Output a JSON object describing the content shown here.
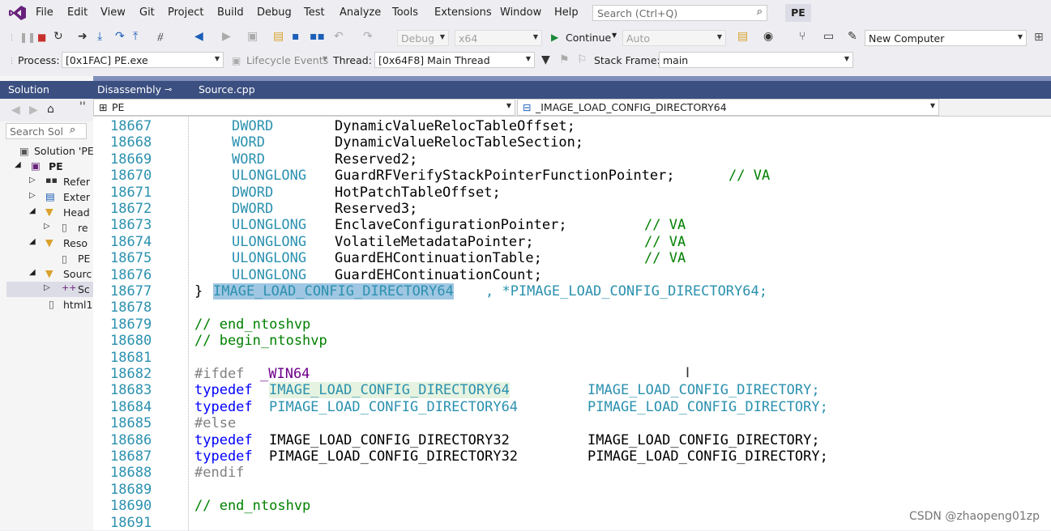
{
  "menubar": {
    "items": [
      "File",
      "Edit",
      "View",
      "Git",
      "Project",
      "Build",
      "Debug",
      "Test",
      "Analyze",
      "Tools",
      "Extensions",
      "Window",
      "Help"
    ],
    "search_placeholder": "Search (Ctrl+Q)",
    "solution_badge": "PE"
  },
  "toolbar1": {
    "config": "Debug",
    "platform": "x64",
    "continue_label": "Continue",
    "startup_item": "Auto",
    "target": "New Computer"
  },
  "toolbar2": {
    "process_label": "Process:",
    "process_value": "[0x1FAC] PE.exe",
    "lifecycle_label": "Lifecycle Events",
    "thread_label": "Thread:",
    "thread_value": "[0x64F8] Main Thread",
    "stackframe_label": "Stack Frame:",
    "stackframe_value": "main"
  },
  "solution_explorer": {
    "title": "Solution Explo...",
    "search_placeholder": "Search Sol",
    "items": [
      "Solution 'PE",
      "PE",
      "Refer",
      "Exter",
      "Head",
      "re",
      "Reso",
      "PE",
      "Sourc",
      "Sc",
      "html1"
    ]
  },
  "tabs": [
    "Disassembly",
    "Source.cpp"
  ],
  "navbar": {
    "scope": "PE",
    "member": "_IMAGE_LOAD_CONFIG_DIRECTORY64"
  },
  "editor": {
    "line_numbers": [
      "18667",
      "18668",
      "18669",
      "18670",
      "18671",
      "18672",
      "18673",
      "18674",
      "18675",
      "18676",
      "18677",
      "18678",
      "18679",
      "18680",
      "18681",
      "18682",
      "18683",
      "18684",
      "18685",
      "18686",
      "18687",
      "18688",
      "18689",
      "18690",
      "18691"
    ],
    "fields": [
      {
        "type": "DWORD",
        "name": "DynamicValueRelocTableOffset;",
        "comment": ""
      },
      {
        "type": "WORD",
        "name": "DynamicValueRelocTableSection;",
        "comment": ""
      },
      {
        "type": "WORD",
        "name": "Reserved2;",
        "comment": ""
      },
      {
        "type": "ULONGLONG",
        "name": "GuardRFVerifyStackPointerFunctionPointer;",
        "comment": "// VA"
      },
      {
        "type": "DWORD",
        "name": "HotPatchTableOffset;",
        "comment": ""
      },
      {
        "type": "DWORD",
        "name": "Reserved3;",
        "comment": ""
      },
      {
        "type": "ULONGLONG",
        "name": "EnclaveConfigurationPointer;",
        "comment": "// VA"
      },
      {
        "type": "ULONGLONG",
        "name": "VolatileMetadataPointer;",
        "comment": "// VA"
      },
      {
        "type": "ULONGLONG",
        "name": "GuardEHContinuationTable;",
        "comment": "// VA"
      },
      {
        "type": "ULONGLONG",
        "name": "GuardEHContinuationCount;",
        "comment": ""
      }
    ],
    "close_brace": "}",
    "struct_name": "IMAGE_LOAD_CONFIG_DIRECTORY64",
    "struct_ptr": ", *PIMAGE_LOAD_CONFIG_DIRECTORY64;",
    "end_comment": "// end_ntoshvp",
    "begin_comment": "// begin_ntoshvp",
    "ifdef": "#ifdef",
    "win64": "_WIN64",
    "typedef": "typedef",
    "td1_src": "IMAGE_LOAD_CONFIG_DIRECTORY64",
    "td1_dst": "IMAGE_LOAD_CONFIG_DIRECTORY;",
    "td2_src": "PIMAGE_LOAD_CONFIG_DIRECTORY64",
    "td2_dst": "PIMAGE_LOAD_CONFIG_DIRECTORY;",
    "else": "#else",
    "td3_src": "IMAGE_LOAD_CONFIG_DIRECTORY32",
    "td3_dst": "IMAGE_LOAD_CONFIG_DIRECTORY;",
    "td4_src": "PIMAGE_LOAD_CONFIG_DIRECTORY32",
    "td4_dst": "PIMAGE_LOAD_CONFIG_DIRECTORY;",
    "endif": "#endif",
    "end_comment2": "// end_ntoshvp"
  },
  "watermark": "CSDN @zhaopeng01zp"
}
